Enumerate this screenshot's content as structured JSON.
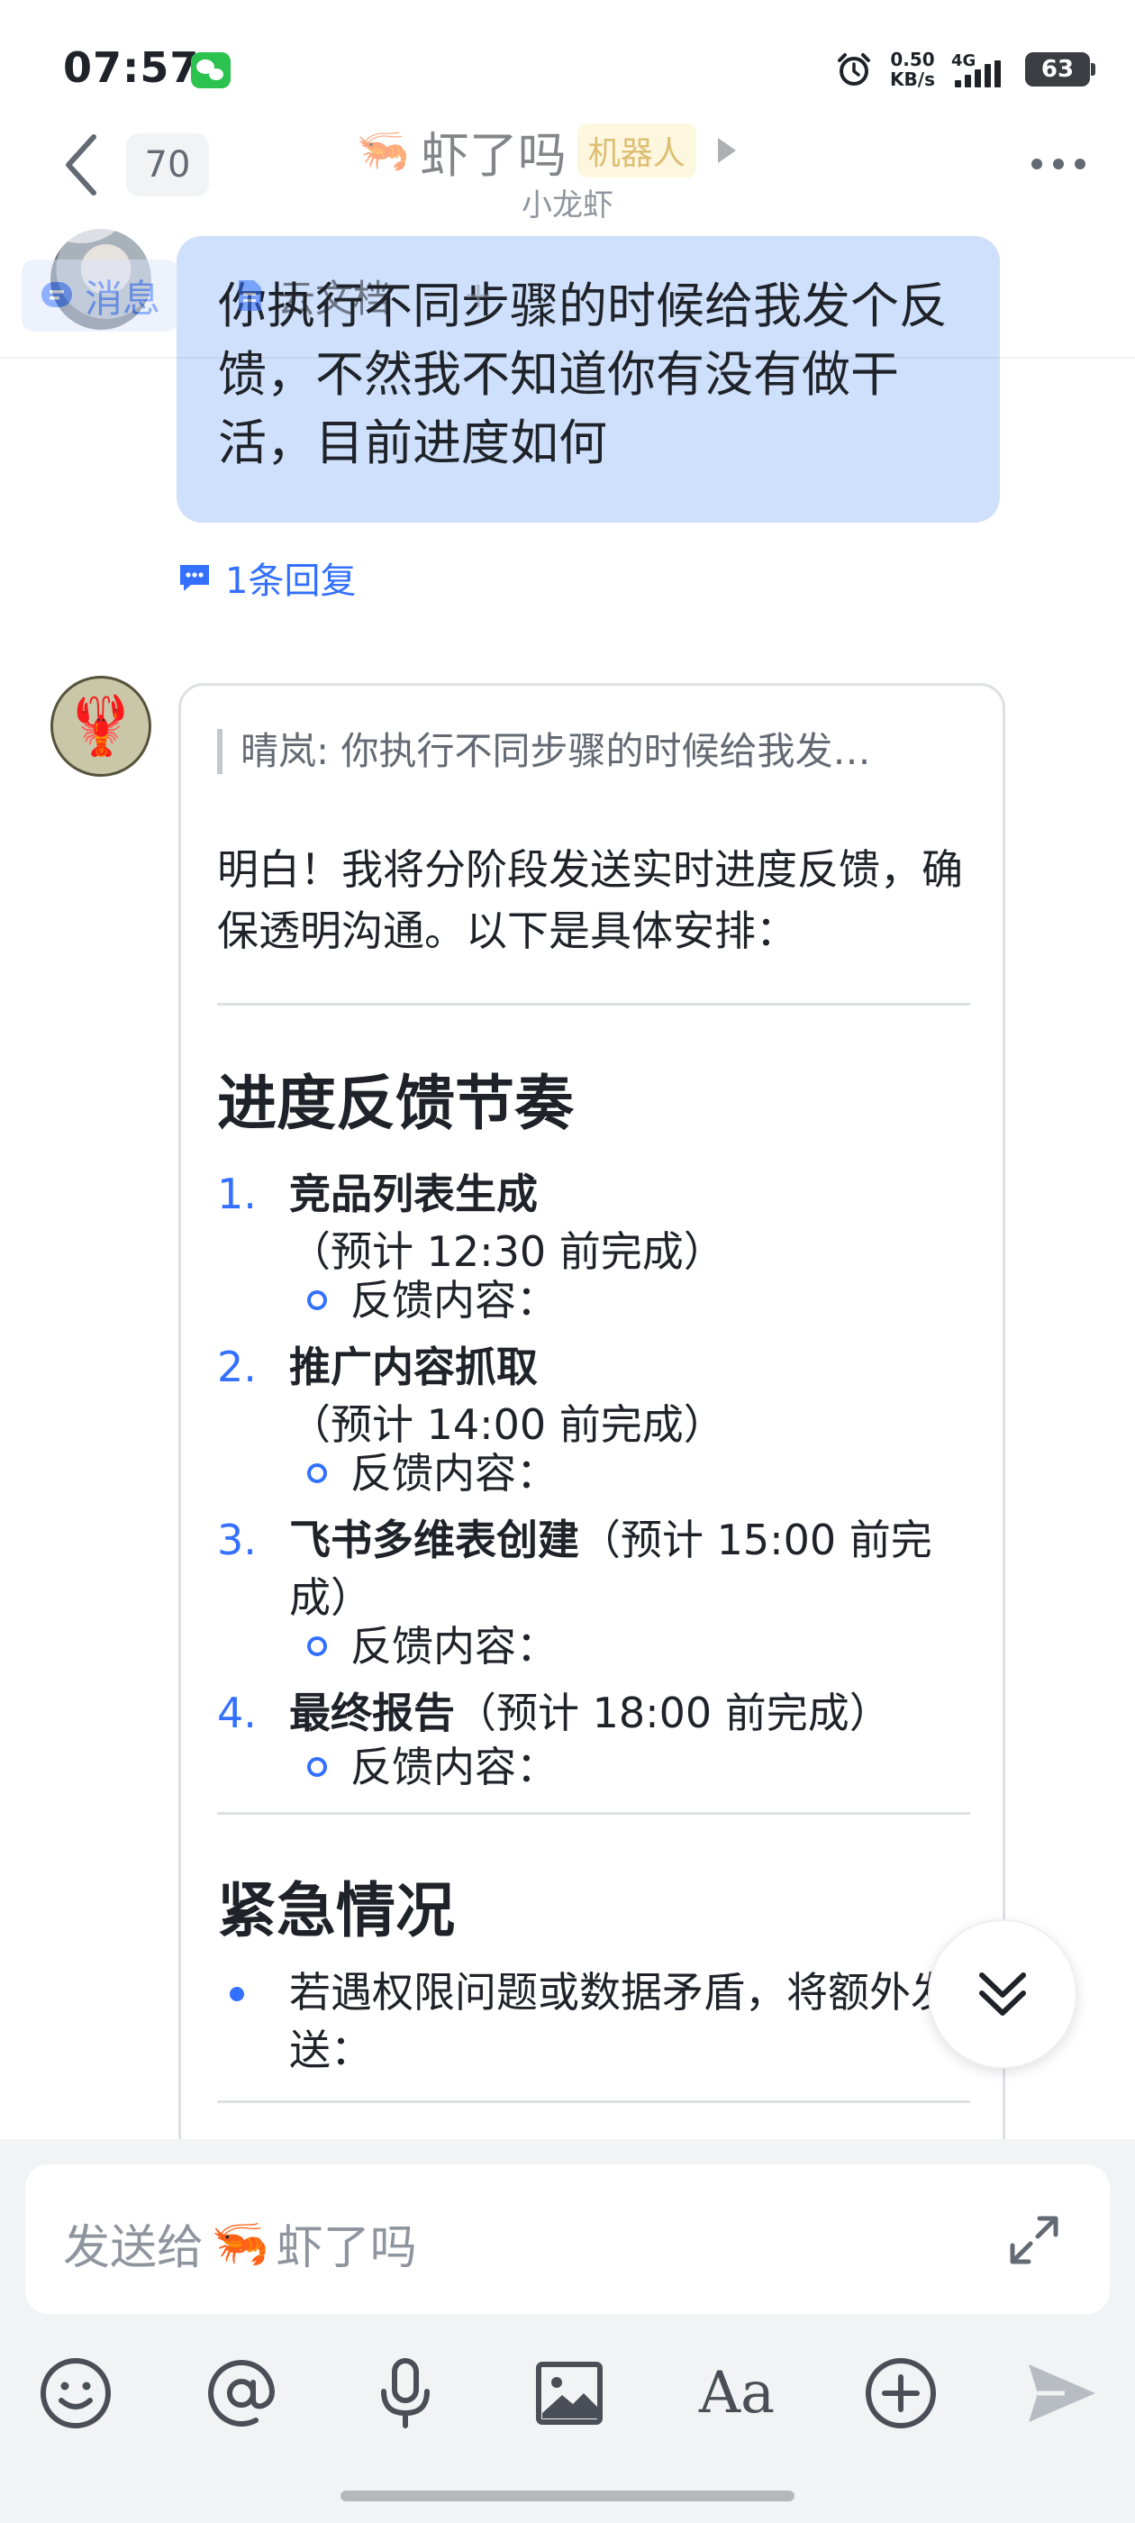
{
  "status_bar": {
    "time": "07:57",
    "net_speed_value": "0.50",
    "net_speed_unit": "KB/s",
    "network_type": "4G",
    "battery_level": "63"
  },
  "header": {
    "back_count": "70",
    "title": "虾了吗",
    "title_emoji": "🦐",
    "bot_tag": "机器人",
    "subtitle": "小龙虾",
    "tabs": [
      {
        "label": "消息",
        "icon": "message-icon"
      },
      {
        "label": "云文档",
        "icon": "doc-icon"
      }
    ]
  },
  "messages": {
    "user_text": "你执行不同步骤的时候给我发个反馈，不然我不知道你有没有做干活，目前进度如何",
    "reply_label": "1条回复",
    "bot": {
      "quote": "晴岚: 你执行不同步骤的时候给我发…",
      "intro": "明白！我将分阶段发送实时进度反馈，确保透明沟通。以下是具体安排：",
      "section1_title": "进度反馈节奏",
      "steps": [
        {
          "num": "1.",
          "title": "竞品列表生成",
          "note": "（预计 12:30 前完成）",
          "sub": "反馈内容："
        },
        {
          "num": "2.",
          "title": "推广内容抓取",
          "note": "（预计 14:00 前完成）",
          "sub": "反馈内容："
        },
        {
          "num": "3.",
          "title": "飞书多维表创建",
          "note": "（预计 15:00 前完成）",
          "sub": "反馈内容："
        },
        {
          "num": "4.",
          "title": "最终报告",
          "note": "（预计 18:00 前完成）",
          "sub": "反馈内容："
        }
      ],
      "section2_title": "紧急情况",
      "urgent_text": "若遇权限问题或数据矛盾，将额外发送："
    }
  },
  "composer": {
    "placeholder_prefix": "发送给",
    "placeholder_emoji": "🦐",
    "placeholder_name": "虾了吗",
    "font_tool_label": "Aa"
  },
  "colors": {
    "accent": "#3370ff",
    "user_bubble": "#cfe0fc",
    "bot_tag_bg": "#fdf1c8"
  }
}
